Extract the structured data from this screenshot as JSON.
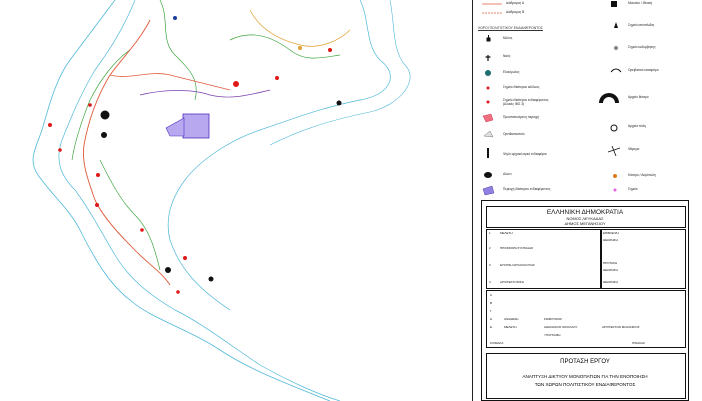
{
  "legend": {
    "boundary_line_1": "Διάδρομος Α",
    "boundary_line_2": "Διάδρομος Β",
    "section_title": "ΧΩΡΟΙ ΠΟΛΙΤΙΣΤΙΚΟΥ ΕΝΔΙΑΦΕΡΟΝΤΟΣ",
    "left_items": [
      "Μύλος",
      "Ναός",
      "Ελαιόμυλος",
      "Σημείο ιδιαίτερου κάλλους",
      "Σημείο ιδιαίτερου ενδιαφέροντος (Αλυκές ΙΜΣ 3)",
      "Προστατευόμενη περιοχή",
      "Ορνιθοσκοπείο",
      "Ψηλό αρχαιολογικό ενδιαφέρον",
      "Αλώνι",
      "Περιοχή ιδιαίτερου ενδιαφέροντος"
    ],
    "right_items": [
      "Μουσείο / Θέαση",
      "Σημείο ιστιοπλοΐας",
      "Σημείο κολύμβησης",
      "Ορειβατικό καταφύγιο",
      "Αρχαίο θέατρο",
      "Αρχαία πόλη",
      "Ψάρεμα",
      "Κάστρο / Ακρόπολη",
      "Σημείο"
    ]
  },
  "title_block": {
    "republic": "ΕΛΛΗΝΙΚΗ ΔΗΜΟΚΡΑΤΙΑ",
    "prefecture": "ΝΟΜΟΣ ΛΕΥΚΑΔΑΣ",
    "municipality": "ΔΗΜΟΣ ΜΕΓΑΝΗΣΙΟΥ",
    "rows": [
      {
        "num": "1",
        "label": "ΜΕΛΕΤΗ",
        "right_label": "ΕΠΙΒΛΕΨΗ",
        "right_sub": "ΘΕΩΡΗΣΗ"
      },
      {
        "num": "2",
        "label": "ΠΡΟΣΦΟΡΑ ΣΥΝΤΑΞΗΣ",
        "right_label": "",
        "right_sub": ""
      },
      {
        "num": "3",
        "label": "ΕΓΚΡΙΣΗ ΑΡΧΑΙΟΛΟΓΙΑΣ",
        "right_label": "ΠΡΟΤΑΣΗ",
        "right_sub": "ΘΕΩΡΗΣΗ"
      },
      {
        "num": "4",
        "label": "ΑΡΧΙΤΕΚΤΟΝΙΚΗ",
        "right_label": "",
        "right_sub": "ΘΕΩΡΗΣΗ"
      }
    ],
    "small_rows": [
      "Α",
      "Β",
      "Γ",
      "Δ",
      "Ε"
    ],
    "engineer_label_1": "ΑΝΑΘΕΣΗ",
    "engineer_label_2": "ΜΕΛΕΤΗ",
    "engineer_name_1": "ΣΩΦΡΟΝΙΟΣ",
    "engineer_name_2": "ΑΘΑΝΑΣΙΟΣ ΝΙΚΟΛΑΟΥ",
    "engineer_role": "ΑΡΧΙΤΕΚΤΩΝ ΜΗΧΑΝΙΚΟΣ",
    "checked": "ΥΠΟΓΡΑΦΗ",
    "scale_label": "ΚΛΙΜΑΚΑ",
    "sheet_label": "ΠΙΝΑΚΑΣ",
    "proposal_heading": "ΠΡΟΤΑΣΗ ΕΡΓΟΥ",
    "proposal_line_1": "ΑΝΑΠΤΥΞΗ ΔΙΚΤΥΟΥ ΜΟΝΟΠΑΤΙΩΝ ΓΙΑ ΤΗΝ ΕΝΟΠΟΙΗΣΗ",
    "proposal_line_2": "ΤΩΝ ΧΩΡΩΝ ΠΟΛΙΤΙΣΤΙΚΟΥ ΕΝΔΙΑΦΕΡΟΝΤΟΣ"
  },
  "colors": {
    "coastline": "#4fb8d8",
    "trail": "#e05a3a",
    "contour": "#3fa63f",
    "poi": "#e01818",
    "purple_zone": "#7a55e0"
  }
}
